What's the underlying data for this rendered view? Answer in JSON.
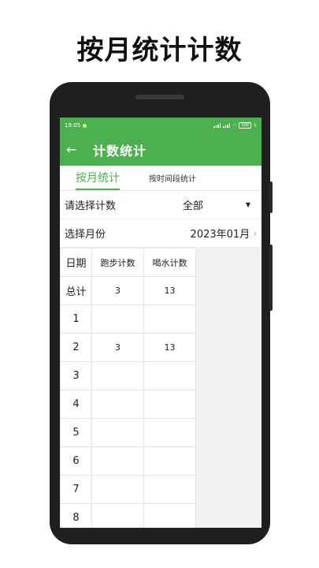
{
  "promo": {
    "title": "按月统计计数"
  },
  "status_bar": {
    "time": "19:05",
    "battery": "100"
  },
  "app_bar": {
    "back_icon": "arrow-left-icon",
    "title": "计数统计"
  },
  "tabs": [
    {
      "label": "按月统计",
      "active": true
    },
    {
      "label": "按时间段统计",
      "active": false
    }
  ],
  "filters": {
    "count_select": {
      "label": "请选择计数",
      "value": "全部"
    },
    "month_select": {
      "label": "选择月份",
      "value": "2023年01月"
    }
  },
  "table": {
    "headers": [
      "日期",
      "跑步计数",
      "喝水计数"
    ],
    "rows": [
      [
        "总计",
        "3",
        "13"
      ],
      [
        "1",
        "",
        ""
      ],
      [
        "2",
        "3",
        "13"
      ],
      [
        "3",
        "",
        ""
      ],
      [
        "4",
        "",
        ""
      ],
      [
        "5",
        "",
        ""
      ],
      [
        "6",
        "",
        ""
      ],
      [
        "7",
        "",
        ""
      ],
      [
        "8",
        "",
        ""
      ]
    ]
  },
  "colors": {
    "accent": "#4caf50",
    "phone_frame": "#1f1f1f",
    "screen_bg": "#f2f2f2"
  }
}
